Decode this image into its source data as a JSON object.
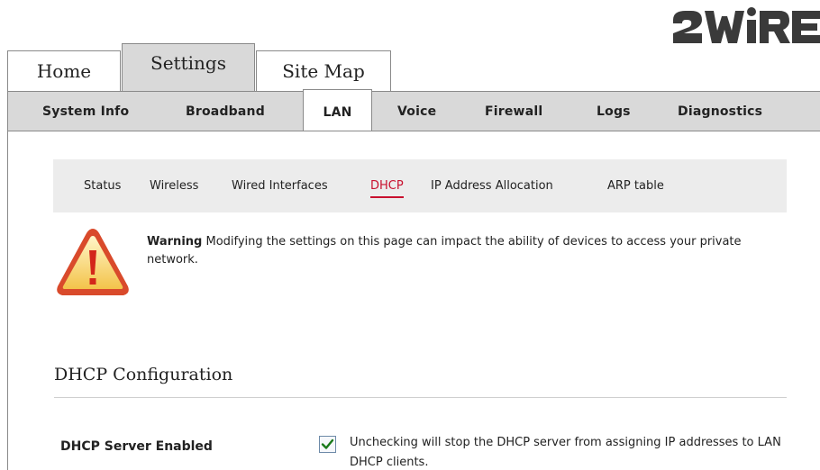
{
  "brand": {
    "logo_text": "2WIRE",
    "color": "#3a3a3a"
  },
  "top_tabs": [
    {
      "label": "Home",
      "active": false
    },
    {
      "label": "Settings",
      "active": true
    },
    {
      "label": "Site Map",
      "active": false
    }
  ],
  "subnav": [
    {
      "label": "System Info",
      "active": false
    },
    {
      "label": "Broadband",
      "active": false
    },
    {
      "label": "LAN",
      "active": true
    },
    {
      "label": "Voice",
      "active": false
    },
    {
      "label": "Firewall",
      "active": false
    },
    {
      "label": "Logs",
      "active": false
    },
    {
      "label": "Diagnostics",
      "active": false
    }
  ],
  "lan_subnav": [
    {
      "label": "Status",
      "active": false
    },
    {
      "label": "Wireless",
      "active": false
    },
    {
      "label": "Wired Interfaces",
      "active": false
    },
    {
      "label": "DHCP",
      "active": true
    },
    {
      "label": "IP Address Allocation",
      "active": false
    },
    {
      "label": "ARP table",
      "active": false
    }
  ],
  "warning": {
    "title": "Warning",
    "message": "Modifying the settings on this page can impact the ability of devices to access your private network.",
    "icon": "warning-triangle-icon"
  },
  "section": {
    "title": "DHCP Configuration"
  },
  "dhcp_server": {
    "label": "DHCP Server Enabled",
    "checked": true,
    "help": "Unchecking will stop the DHCP server from assigning IP addresses to LAN DHCP clients."
  },
  "colors": {
    "accent": "#c8102e",
    "nav_bg": "#d9d9d9",
    "subnav_bg": "#ececec"
  }
}
